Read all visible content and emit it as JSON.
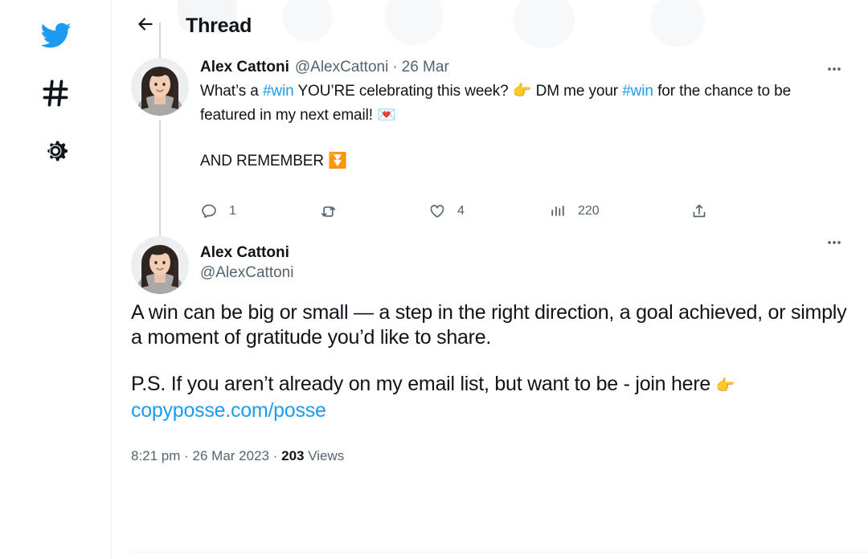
{
  "sidebar": {
    "items": [
      {
        "name": "twitter-logo",
        "icon": "twitter-bird-icon",
        "label": "Twitter",
        "color": "#1d9bf0"
      },
      {
        "name": "explore",
        "icon": "hashtag-icon",
        "label": "Explore"
      },
      {
        "name": "settings",
        "icon": "gear-icon",
        "label": "Settings"
      }
    ]
  },
  "header": {
    "back_label": "Back",
    "back_icon": "arrow-left-icon",
    "title": "Thread"
  },
  "colors": {
    "accent": "#1d9bf0",
    "text": "#0f1419",
    "muted": "#536471",
    "thread_line": "#cfd9de",
    "divider": "#eff3f4"
  },
  "tweets": [
    {
      "display_name": "Alex Cattoni",
      "handle": "@AlexCattoni",
      "separator": "·",
      "date": "26 Mar",
      "more_label": "More",
      "text": {
        "p1_a": "What’s a ",
        "p1_hashtag1": "#win",
        "p1_b": " YOU’RE celebrating this week? ",
        "p1_emoji1": "👉",
        "p1_c": " DM me your ",
        "p1_hashtag2": "#win",
        "p1_d": " for the chance to be featured in my next email! ",
        "p1_emoji2": "💌",
        "p2_a": "AND REMEMBER ",
        "p2_emoji": "⏬"
      },
      "actions": [
        {
          "name": "reply",
          "icon": "reply-icon",
          "count": "1"
        },
        {
          "name": "retweet",
          "icon": "retweet-icon",
          "count": ""
        },
        {
          "name": "like",
          "icon": "heart-icon",
          "count": "4"
        },
        {
          "name": "views",
          "icon": "analytics-icon",
          "count": "220"
        },
        {
          "name": "share",
          "icon": "share-icon",
          "count": ""
        }
      ]
    },
    {
      "display_name": "Alex Cattoni",
      "handle": "@AlexCattoni",
      "more_label": "More",
      "body": {
        "p1": "A win can be big or small — a step in the right direction, a goal achieved, or simply a moment of gratitude you’d like to share.",
        "p2_a": "P.S. If you aren’t already on my email list, but want to be - join here ",
        "p2_emoji": "👉",
        "link_text": "copyposse.com/posse"
      },
      "meta": {
        "time": "8:21 pm",
        "sep1": " · ",
        "date": "26 Mar 2023",
        "sep2": " · ",
        "views_count": "203",
        "views_label": " Views"
      }
    }
  ]
}
